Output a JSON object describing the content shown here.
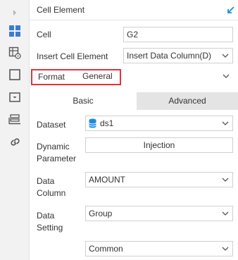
{
  "rail": {
    "icons": [
      "expand-arrow-icon",
      "cell-element-icon",
      "cell-attribute-icon",
      "widget-icon",
      "popup-icon",
      "report-list-icon",
      "link-icon"
    ]
  },
  "header": {
    "title": "Cell Element"
  },
  "form": {
    "cell_label": "Cell",
    "cell_value": "G2",
    "insert_label": "Insert Cell Element",
    "insert_value": "Insert Data Column(D)",
    "format_label": "Format",
    "format_value": "General"
  },
  "tabs": {
    "basic": "Basic",
    "advanced": "Advanced"
  },
  "basic": {
    "dataset_label": "Dataset",
    "dataset_value": "ds1",
    "dynamic_label_1": "Dynamic",
    "dynamic_label_2": "Parameter",
    "injection_label": "Injection",
    "column_label_1": "Data",
    "column_label_2": "Column",
    "column_value": "AMOUNT",
    "setting_label_1": "Data",
    "setting_label_2": "Setting",
    "setting_value": "Group",
    "common_value": "Common"
  },
  "colors": {
    "accent": "#1a8ae8",
    "highlight": "#e0353b",
    "active_icon": "#3a7bd5"
  }
}
